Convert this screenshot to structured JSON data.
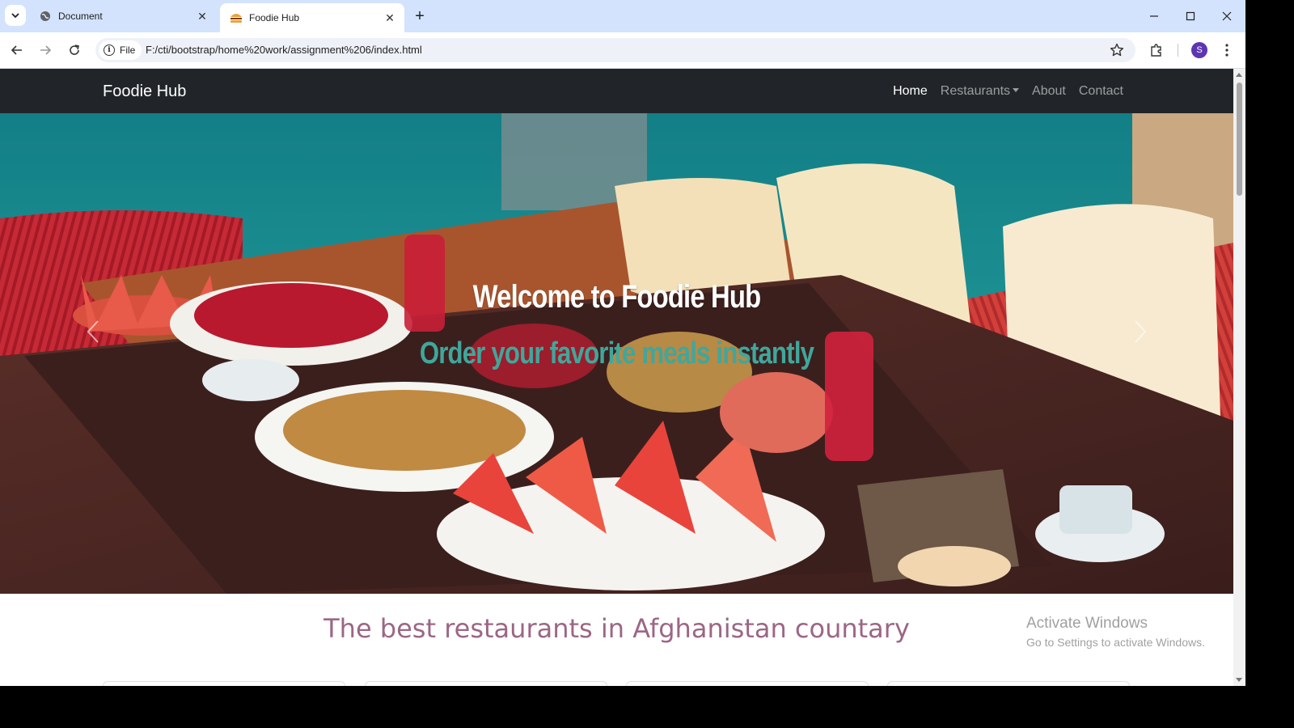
{
  "browser": {
    "tabs": [
      {
        "title": "Document",
        "active": false
      },
      {
        "title": "Foodie Hub",
        "active": true
      }
    ],
    "chip_label": "File",
    "url": "F:/cti/bootstrap/home%20work/assignment%206/index.html",
    "profile_initial": "S"
  },
  "navbar": {
    "brand": "Foodie Hub",
    "links": [
      {
        "label": "Home",
        "active": true
      },
      {
        "label": "Restaurants",
        "dropdown": true
      },
      {
        "label": "About"
      },
      {
        "label": "Contact"
      }
    ]
  },
  "hero": {
    "title": "Welcome to Foodie Hub",
    "subtitle": "Order your favorite meals instantly",
    "subtitle_color": "#3fa79c"
  },
  "section": {
    "title": "The best restaurants in Afghanistan countary",
    "title_color": "#9c6685"
  },
  "watermark": {
    "line1": "Activate Windows",
    "line2": "Go to Settings to activate Windows."
  },
  "colors": {
    "navbar_bg": "#212529",
    "tabstrip_bg": "#d3e3fd"
  }
}
